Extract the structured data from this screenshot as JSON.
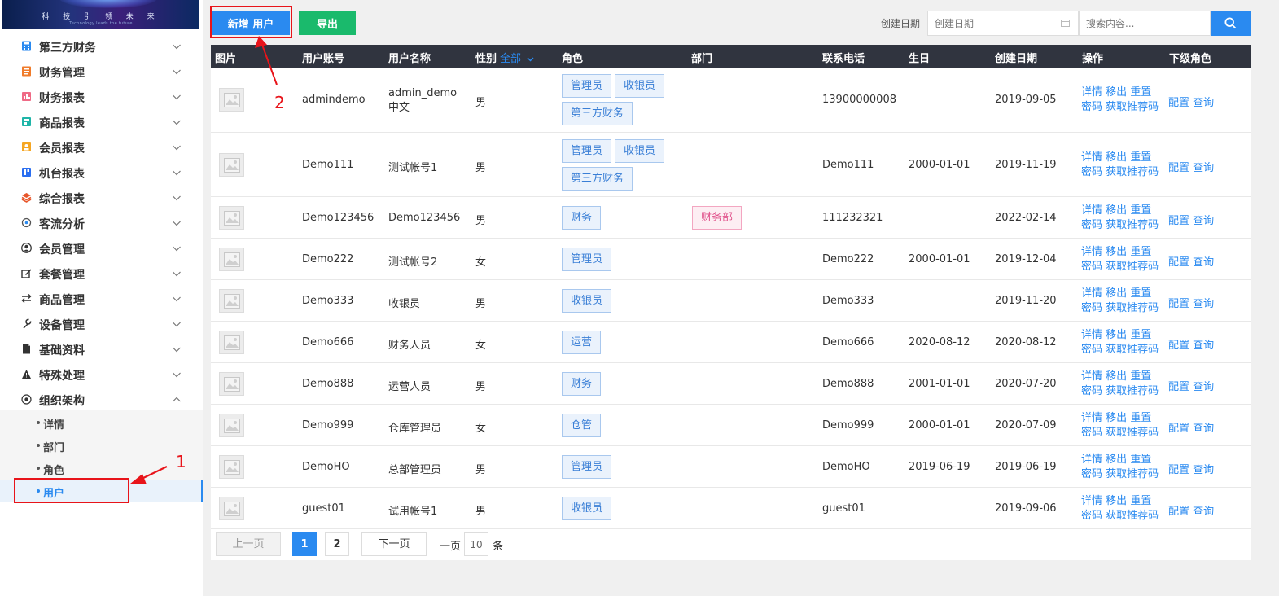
{
  "banner": {
    "text": "科 技 引 领 未 来",
    "subtext": "Technology leads the future"
  },
  "sidebar": {
    "items": [
      {
        "label": "第三方财务",
        "icon": "calculator-icon"
      },
      {
        "label": "财务管理",
        "icon": "ledger-icon"
      },
      {
        "label": "财务报表",
        "icon": "chart-book-icon"
      },
      {
        "label": "商品报表",
        "icon": "goods-report-icon"
      },
      {
        "label": "会员报表",
        "icon": "member-report-icon"
      },
      {
        "label": "机台报表",
        "icon": "machine-report-icon"
      },
      {
        "label": "综合报表",
        "icon": "layers-icon"
      },
      {
        "label": "客流分析",
        "icon": "target-icon"
      },
      {
        "label": "会员管理",
        "icon": "user-circle-icon"
      },
      {
        "label": "套餐管理",
        "icon": "edit-box-icon"
      },
      {
        "label": "商品管理",
        "icon": "exchange-icon"
      },
      {
        "label": "设备管理",
        "icon": "wrench-icon"
      },
      {
        "label": "基础资料",
        "icon": "document-icon"
      },
      {
        "label": "特殊处理",
        "icon": "warning-icon"
      },
      {
        "label": "组织架构",
        "icon": "org-icon"
      }
    ],
    "submenu": [
      "详情",
      "部门",
      "角色",
      "用户"
    ],
    "active_sub": "用户"
  },
  "toolbar": {
    "add_label": "新增 用户",
    "export_label": "导出",
    "date_label": "创建日期",
    "date_placeholder": "创建日期",
    "search_placeholder": "搜索内容..."
  },
  "table": {
    "headers": {
      "photo": "图片",
      "account": "用户账号",
      "name": "用户名称",
      "gender": "性别",
      "gender_filter": "全部",
      "roles": "角色",
      "dept": "部门",
      "phone": "联系电话",
      "birthday": "生日",
      "created": "创建日期",
      "ops": "操作",
      "sub_roles": "下级角色"
    },
    "ops_labels": {
      "detail": "详情",
      "remove": "移出",
      "reset": "重置",
      "password": "密码",
      "get_code": "获取推荐码"
    },
    "sub_ops_labels": {
      "config": "配置",
      "query": "查询"
    },
    "rows": [
      {
        "account": "admindemo",
        "name": "admin_demo中文",
        "gender": "男",
        "roles": [
          "管理员",
          "收银员",
          "第三方财务"
        ],
        "dept": "",
        "phone": "13900000008",
        "birthday": "",
        "created": "2019-09-05"
      },
      {
        "account": "Demo111",
        "name": "测试帐号1",
        "gender": "男",
        "roles": [
          "管理员",
          "收银员",
          "第三方财务"
        ],
        "dept": "",
        "phone": "Demo111",
        "birthday": "2000-01-01",
        "created": "2019-11-19"
      },
      {
        "account": "Demo123456",
        "name": "Demo123456",
        "gender": "男",
        "roles": [
          "财务"
        ],
        "dept": "财务部",
        "phone": "111232321",
        "birthday": "",
        "created": "2022-02-14"
      },
      {
        "account": "Demo222",
        "name": "测试帐号2",
        "gender": "女",
        "roles": [
          "管理员"
        ],
        "dept": "",
        "phone": "Demo222",
        "birthday": "2000-01-01",
        "created": "2019-12-04"
      },
      {
        "account": "Demo333",
        "name": "收银员",
        "gender": "男",
        "roles": [
          "收银员"
        ],
        "dept": "",
        "phone": "Demo333",
        "birthday": "",
        "created": "2019-11-20"
      },
      {
        "account": "Demo666",
        "name": "财务人员",
        "gender": "女",
        "roles": [
          "运营"
        ],
        "dept": "",
        "phone": "Demo666",
        "birthday": "2020-08-12",
        "created": "2020-08-12"
      },
      {
        "account": "Demo888",
        "name": "运营人员",
        "gender": "男",
        "roles": [
          "财务"
        ],
        "dept": "",
        "phone": "Demo888",
        "birthday": "2001-01-01",
        "created": "2020-07-20"
      },
      {
        "account": "Demo999",
        "name": "仓库管理员",
        "gender": "女",
        "roles": [
          "仓管"
        ],
        "dept": "",
        "phone": "Demo999",
        "birthday": "2000-01-01",
        "created": "2020-07-09"
      },
      {
        "account": "DemoHO",
        "name": "总部管理员",
        "gender": "男",
        "roles": [
          "管理员"
        ],
        "dept": "",
        "phone": "DemoHO",
        "birthday": "2019-06-19",
        "created": "2019-06-19"
      },
      {
        "account": "guest01",
        "name": "试用帐号1",
        "gender": "男",
        "roles": [
          "收银员"
        ],
        "dept": "",
        "phone": "guest01",
        "birthday": "",
        "created": "2019-09-06"
      }
    ]
  },
  "pagination": {
    "prev": "上一页",
    "pages": [
      "1",
      "2"
    ],
    "current": "1",
    "next": "下一页",
    "per_page_label": "一页",
    "page_size": "10",
    "unit": "条"
  },
  "annotations": {
    "one": "1",
    "two": "2"
  },
  "colors": {
    "primary": "#2a8af0",
    "export": "#1aba6c",
    "header": "#30343f",
    "annotation": "#e8141a",
    "dept_tag": "#e0508a"
  }
}
